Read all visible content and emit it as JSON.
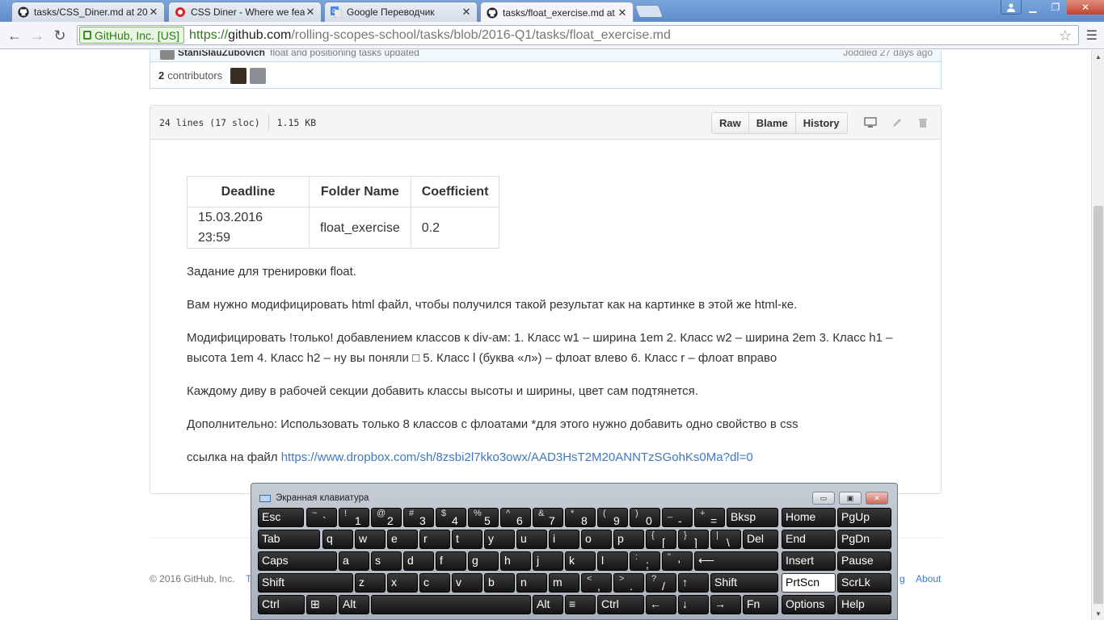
{
  "browser": {
    "tabs": [
      {
        "title": "tasks/CSS_Diner.md at 201",
        "icon": "github-icon"
      },
      {
        "title": "CSS Diner - Where we feas",
        "icon": "record-icon"
      },
      {
        "title": "Google Переводчик",
        "icon": "google-translate-icon"
      },
      {
        "title": "tasks/float_exercise.md at",
        "icon": "github-icon"
      }
    ],
    "ev_label": "GitHub, Inc. [US]",
    "url_scheme": "https://",
    "url_host": "github.com",
    "url_path": "/rolling-scopes-school/tasks/blob/2016-Q1/tasks/float_exercise.md"
  },
  "commit": {
    "author": "StaniSlauZubovich",
    "message": "float and positioning tasks updated",
    "when": "Joddled 27 days ago",
    "contributors_count": "2",
    "contributors_label": "contributors"
  },
  "file": {
    "lines": "24 lines (17 sloc)",
    "size": "1.15 KB",
    "buttons": {
      "raw": "Raw",
      "blame": "Blame",
      "history": "History"
    }
  },
  "markdown": {
    "table": {
      "headers": [
        "Deadline",
        "Folder Name",
        "Coefficient"
      ],
      "row": [
        "15.03.2016 23:59",
        "float_exercise",
        "0.2"
      ]
    },
    "p1": "Задание для тренировки float.",
    "p2": "Вам нужно модифицировать html файл, чтобы получился такой результат как на картинке в этой же html-ке.",
    "p3": "Модифицировать !только! добавлением классов к div-ам: 1. Класс w1 – ширина 1em 2. Класс w2 – ширина 2em 3. Класс h1 – высота 1em 4. Класс h2 – ну вы поняли □ 5. Класс l (буква «л») – флоат влево 6. Класс r – флоат вправо",
    "p4": "Каждому диву в рабочей секции добавить классы высоты и ширины, цвет сам подтянется.",
    "p5": "Дополнительно: Использовать только 8 классов с флоатами *для этого нужно добавить одно свойство в css",
    "p6_prefix": "ссылка на файл ",
    "p6_link": "https://www.dropbox.com/sh/8zsbi2l7kko3owx/AAD3HsT2M20ANNTzSGohKs0Ma?dl=0"
  },
  "footer": {
    "copyright": "© 2016 GitHub, Inc.",
    "link_left": "T",
    "link_blog_tail": "g",
    "link_about": "About"
  },
  "osk": {
    "title": "Экранная клавиатура",
    "rows": [
      [
        {
          "t": "Esc"
        },
        {
          "lo": "~",
          "up": "`"
        },
        {
          "lo": "!",
          "up": "1"
        },
        {
          "lo": "@",
          "up": "2"
        },
        {
          "lo": "#",
          "up": "3"
        },
        {
          "lo": "$",
          "up": "4"
        },
        {
          "lo": "%",
          "up": "5"
        },
        {
          "lo": "^",
          "up": "6"
        },
        {
          "lo": "&",
          "up": "7"
        },
        {
          "lo": "*",
          "up": "8"
        },
        {
          "lo": "(",
          "up": "9"
        },
        {
          "lo": ")",
          "up": "0"
        },
        {
          "lo": "_",
          "up": "-"
        },
        {
          "lo": "+",
          "up": "="
        },
        {
          "t": "Bksp"
        },
        {
          "t": "Home"
        },
        {
          "t": "PgUp"
        }
      ],
      [
        {
          "t": "Tab"
        },
        {
          "t": "q"
        },
        {
          "t": "w"
        },
        {
          "t": "e"
        },
        {
          "t": "r"
        },
        {
          "t": "t"
        },
        {
          "t": "y"
        },
        {
          "t": "u"
        },
        {
          "t": "i"
        },
        {
          "t": "o"
        },
        {
          "t": "p"
        },
        {
          "lo": "{",
          "up": "["
        },
        {
          "lo": "}",
          "up": "]"
        },
        {
          "lo": "|",
          "up": "\\"
        },
        {
          "t": "Del"
        },
        {
          "t": "End"
        },
        {
          "t": "PgDn"
        }
      ],
      [
        {
          "t": "Caps"
        },
        {
          "t": "a"
        },
        {
          "t": "s"
        },
        {
          "t": "d"
        },
        {
          "t": "f"
        },
        {
          "t": "g"
        },
        {
          "t": "h"
        },
        {
          "t": "j"
        },
        {
          "t": "k"
        },
        {
          "t": "l"
        },
        {
          "lo": ":",
          "up": ";"
        },
        {
          "lo": "\"",
          "up": "'"
        },
        {
          "t": "⟵"
        },
        {
          "t": "Insert"
        },
        {
          "t": "Pause"
        }
      ],
      [
        {
          "t": "Shift"
        },
        {
          "t": "z"
        },
        {
          "t": "x"
        },
        {
          "t": "c"
        },
        {
          "t": "v"
        },
        {
          "t": "b"
        },
        {
          "t": "n"
        },
        {
          "t": "m"
        },
        {
          "lo": "<",
          "up": ","
        },
        {
          "lo": ">",
          "up": "."
        },
        {
          "lo": "?",
          "up": "/"
        },
        {
          "t": "↑"
        },
        {
          "t": "Shift"
        },
        {
          "t": "PrtScn"
        },
        {
          "t": "ScrLk"
        }
      ],
      [
        {
          "t": "Ctrl"
        },
        {
          "t": "⊞"
        },
        {
          "t": "Alt"
        },
        {
          "t": ""
        },
        {
          "t": "Alt"
        },
        {
          "t": "≡"
        },
        {
          "t": "Ctrl"
        },
        {
          "t": "←"
        },
        {
          "t": "↓"
        },
        {
          "t": "→"
        },
        {
          "t": "Fn"
        },
        {
          "t": "Options"
        },
        {
          "t": "Help"
        }
      ]
    ]
  }
}
